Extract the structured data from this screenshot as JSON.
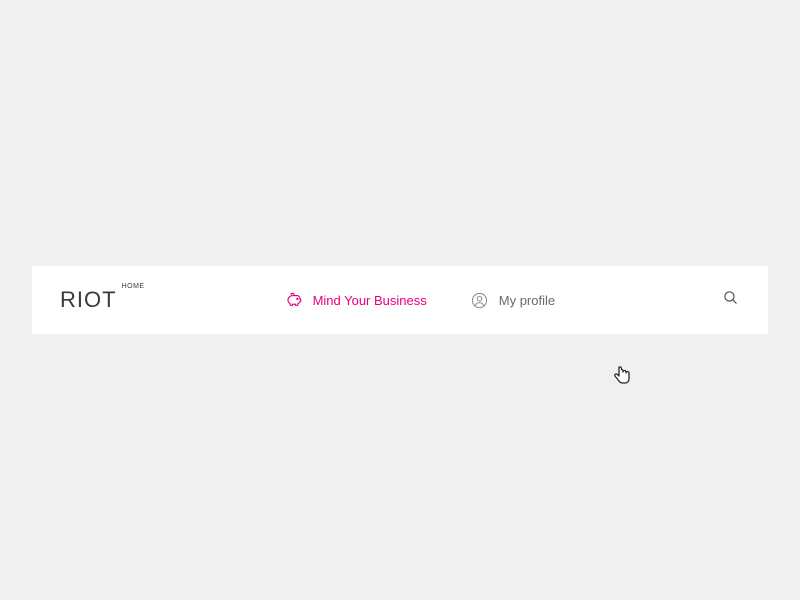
{
  "logo": {
    "text": "RIOT",
    "sup": "HOME"
  },
  "nav": {
    "items": [
      {
        "label": "Mind Your Business",
        "icon": "piggy-bank-icon",
        "active": true
      },
      {
        "label": "My profile",
        "icon": "profile-icon",
        "active": false
      }
    ]
  },
  "colors": {
    "accent": "#e6007e",
    "text": "#6a6a6a",
    "logo": "#3a3a3a"
  }
}
